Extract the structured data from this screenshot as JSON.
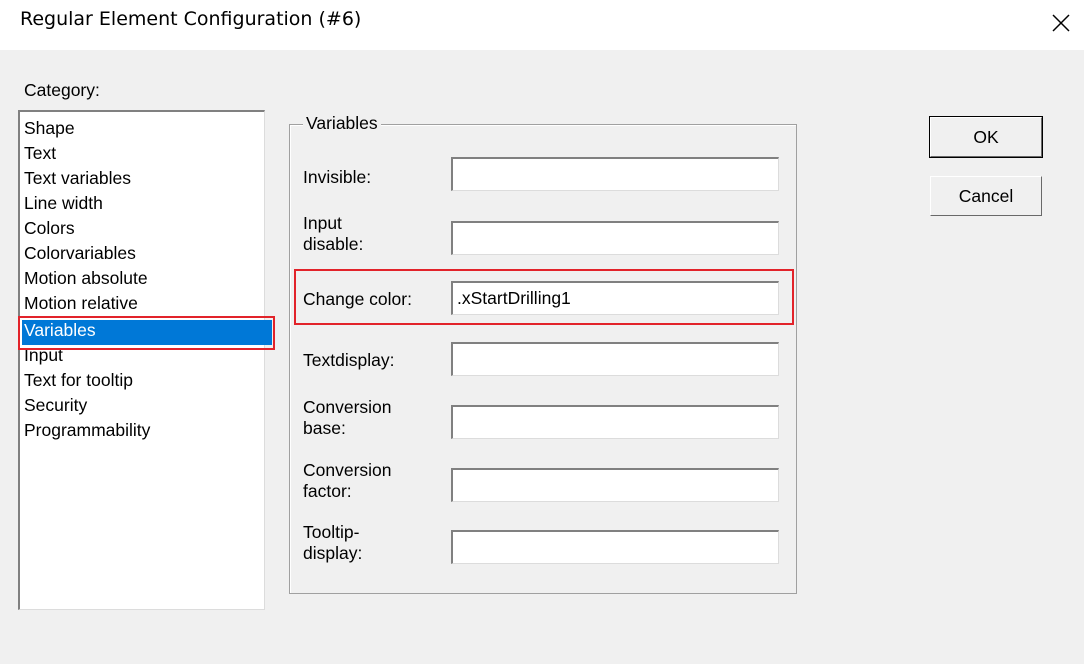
{
  "window": {
    "title": "Regular Element Configuration (#6)",
    "close_icon": "close-x-icon"
  },
  "category": {
    "label": "Category:",
    "items": [
      "Shape",
      "Text",
      "Text variables",
      "Line width",
      "Colors",
      "Colorvariables",
      "Motion absolute",
      "Motion relative",
      "Variables",
      "Input",
      "Text for tooltip",
      "Security",
      "Programmability"
    ],
    "selected": "Variables"
  },
  "variables": {
    "group_title": "Variables",
    "fields": [
      {
        "label": "Invisible:",
        "value": ""
      },
      {
        "label": "Input\ndisable:",
        "value": ""
      },
      {
        "label": "Change color:",
        "value": ".xStartDrilling1"
      },
      {
        "label": "Textdisplay:",
        "value": ""
      },
      {
        "label": "Conversion\nbase:",
        "value": ""
      },
      {
        "label": "Conversion\nfactor:",
        "value": ""
      },
      {
        "label": "Tooltip-\ndisplay:",
        "value": ""
      }
    ]
  },
  "buttons": {
    "ok": "OK",
    "cancel": "Cancel"
  },
  "colors": {
    "selection": "#0078d7",
    "highlight": "#e2232a"
  }
}
